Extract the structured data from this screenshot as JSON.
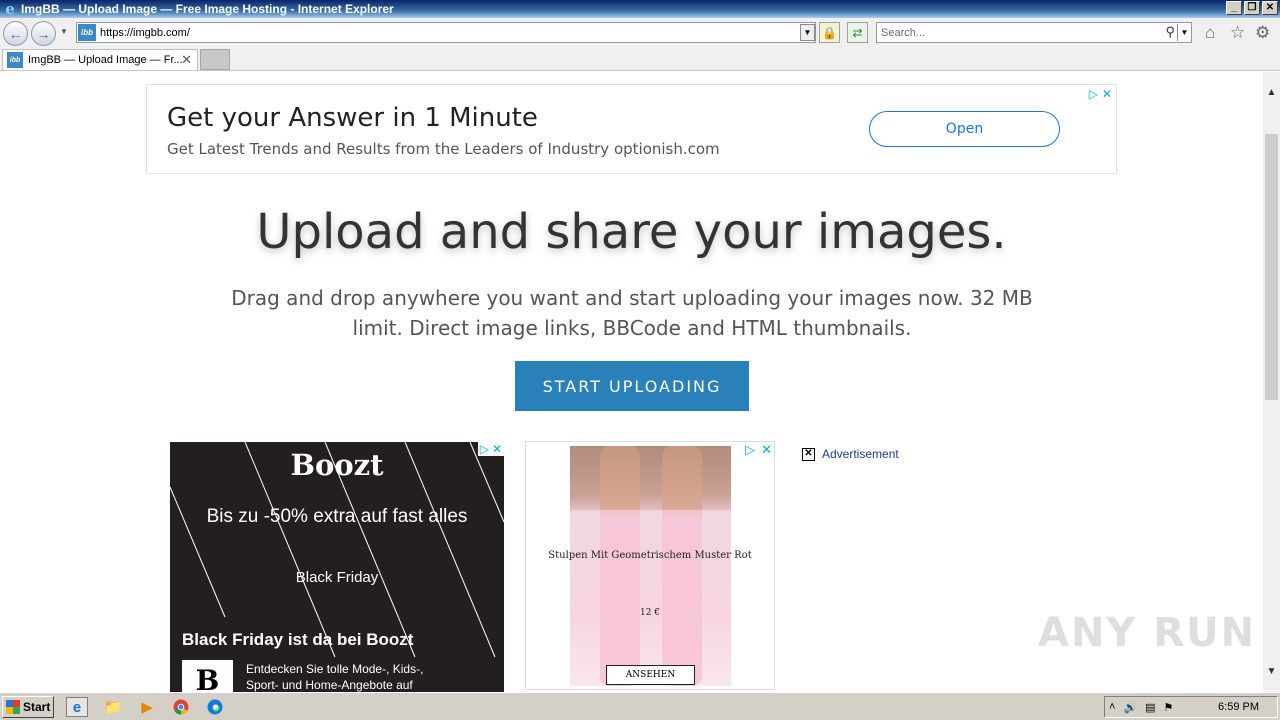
{
  "window": {
    "title": "ImgBB — Upload Image — Free Image Hosting - Internet Explorer",
    "buttons": [
      "_",
      "❐",
      "✕"
    ]
  },
  "nav": {
    "url": "https://imgbb.com/",
    "search_placeholder": "Search...",
    "site_icon_text": "ibb"
  },
  "tabs": [
    {
      "label": "ImgBB — Upload Image — Fr...",
      "icon": "ibb"
    }
  ],
  "top_ad": {
    "headline": "Get your Answer in 1 Minute",
    "subline": "Get Latest Trends and Results from the Leaders of Industry optionish.com",
    "button": "Open"
  },
  "hero": {
    "title": "Upload and share your images.",
    "text": "Drag and drop anywhere you want and start uploading your images now. 32 MB limit. Direct image links, BBCode and HTML thumbnails.",
    "button": "START UPLOADING"
  },
  "boozt_ad": {
    "logo": "Boozt",
    "offer": "Bis zu -50% extra auf fast alles",
    "tag": "Black Friday",
    "headline": "Black Friday ist da bei Boozt",
    "brand_mark": "B",
    "description": "Entdecken Sie tolle Mode-, Kids-, Sport- und Home-Angebote auf"
  },
  "socks_ad": {
    "product": "Stulpen Mit Geometrischem Muster Rot",
    "price": "12 €",
    "button": "ANSEHEN"
  },
  "advertisement_label": "Advertisement",
  "watermark": "ANY RUN",
  "taskbar": {
    "start": "Start",
    "clock": "6:59 PM"
  }
}
